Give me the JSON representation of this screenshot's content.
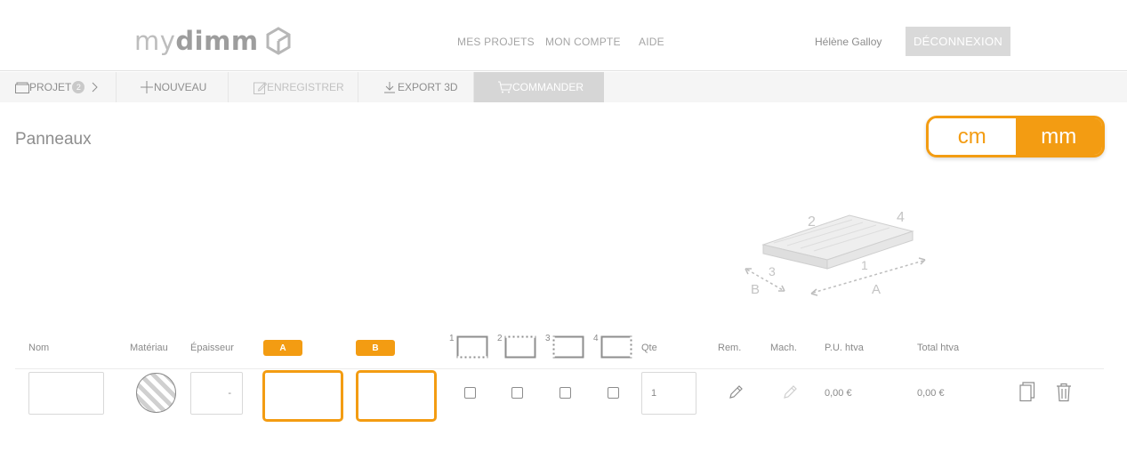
{
  "header": {
    "logo_light": "my",
    "logo_bold": "dimm",
    "nav": [
      "MES PROJETS",
      "MON COMPTE",
      "AIDE"
    ],
    "user_name": "Hélène Galloy",
    "logout_label": "DÉCONNEXION"
  },
  "toolbar": {
    "projet_label": "PROJET",
    "projet_count": "2",
    "nouveau_label": "NOUVEAU",
    "enregistrer_label": "ENREGISTRER",
    "export_label": "EXPORT 3D",
    "commander_label": "COMMANDER"
  },
  "page": {
    "title": "Panneaux"
  },
  "units": {
    "options": [
      "cm",
      "mm"
    ],
    "selected": "mm"
  },
  "illustration": {
    "edge_labels": [
      "1",
      "2",
      "3",
      "4"
    ],
    "dim_labels": [
      "A",
      "B"
    ]
  },
  "table": {
    "headers": {
      "nom": "Nom",
      "materiau": "Matériau",
      "epaisseur": "Épaisseur",
      "dim_a": "A",
      "dim_b": "B",
      "edges": [
        "1",
        "2",
        "3",
        "4"
      ],
      "qte": "Qte",
      "rem": "Rem.",
      "mach": "Mach.",
      "pu": "P.U. htva",
      "total": "Total htva"
    },
    "row": {
      "nom": "",
      "epaisseur": "-",
      "dim_a": "",
      "dim_b": "",
      "edges_checked": [
        false,
        false,
        false,
        false
      ],
      "qte": "1",
      "pu": "0,00 €",
      "total": "0,00 €"
    }
  },
  "colors": {
    "accent": "#f39c12",
    "text_gray": "#8a8a8a",
    "toolbar_bg": "#f5f5f5",
    "active_tab_bg": "#d6d6d6"
  }
}
